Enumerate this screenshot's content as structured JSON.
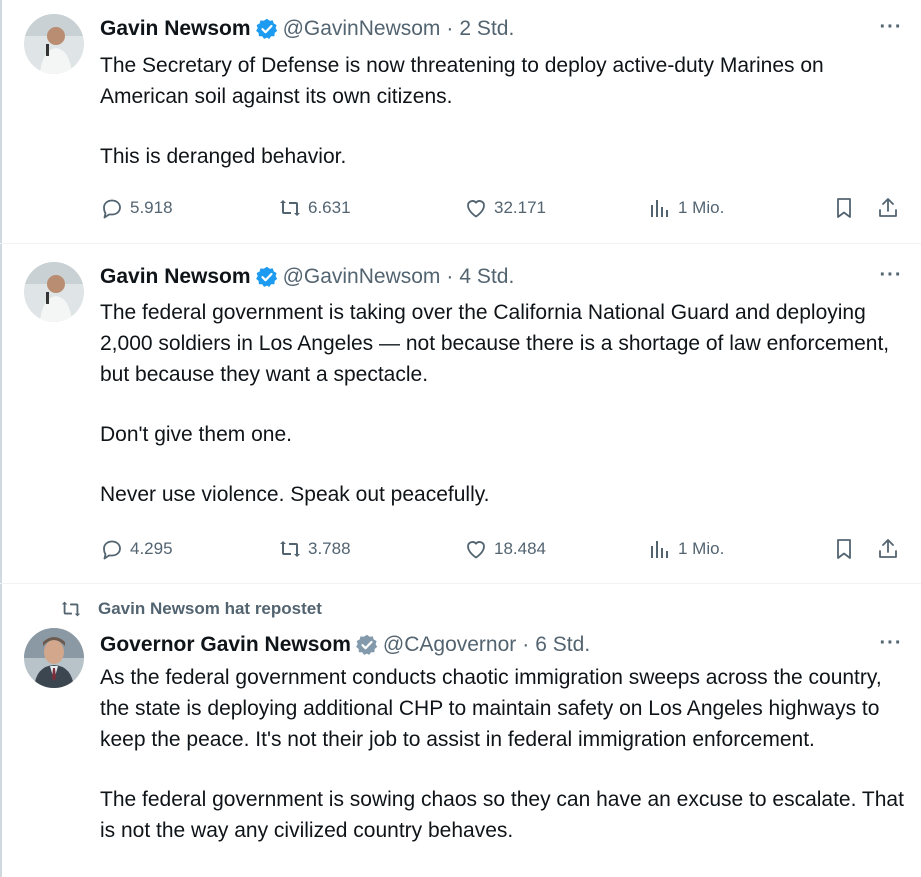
{
  "colors": {
    "text": "#0f1419",
    "muted": "#536471",
    "verified_blue": "#1d9bf0",
    "verified_gray": "#829aab",
    "divider": "#eff3f4"
  },
  "tweets": [
    {
      "name": "Gavin Newsom",
      "verified": "blue",
      "handle": "@GavinNewsom",
      "time": "2 Std.",
      "paragraphs": [
        "The Secretary of Defense is now threatening to deploy active-duty Marines on American soil against its own citizens.",
        "This is deranged behavior."
      ],
      "replies": "5.918",
      "reposts": "6.631",
      "likes": "32.171",
      "views": "1 Mio."
    },
    {
      "name": "Gavin Newsom",
      "verified": "blue",
      "handle": "@GavinNewsom",
      "time": "4 Std.",
      "paragraphs": [
        "The federal government is taking over the California National Guard and deploying 2,000 soldiers in Los Angeles — not because there is a shortage of law enforcement, but because they want a spectacle.",
        "Don't give them one.",
        "Never use violence. Speak out peacefully."
      ],
      "replies": "4.295",
      "reposts": "3.788",
      "likes": "18.484",
      "views": "1 Mio."
    },
    {
      "repost_label": "Gavin Newsom hat repostet",
      "name": "Governor Gavin Newsom",
      "verified": "gray",
      "handle": "@CAgovernor",
      "time": "6 Std.",
      "paragraphs": [
        "As the federal government conducts chaotic immigration sweeps across the country, the state is deploying additional CHP to maintain safety on Los Angeles highways to keep the peace. It's not their job to assist in federal immigration enforcement.",
        "The federal government is sowing chaos so they can have an excuse to escalate. That is not the way any civilized country behaves."
      ]
    }
  ],
  "icons": {
    "more": "more-dots-icon",
    "reply": "reply-bubble-icon",
    "repost": "repost-arrows-icon",
    "like": "heart-icon",
    "views": "views-bars-icon",
    "bookmark": "bookmark-icon",
    "share": "share-upload-icon"
  },
  "separator": "·",
  "more_glyph": "···"
}
